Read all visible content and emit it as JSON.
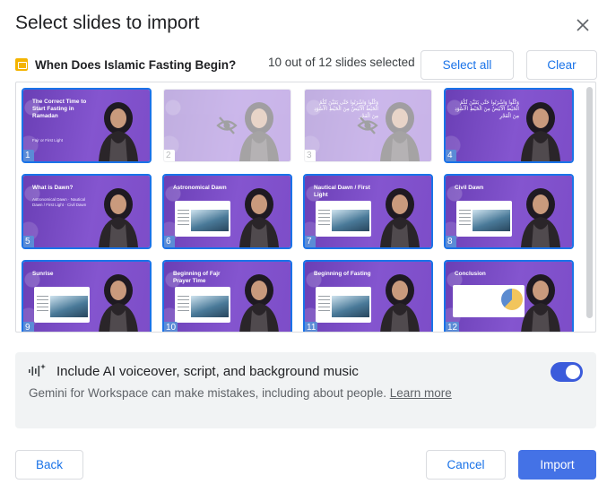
{
  "dialog": {
    "title": "Select slides to import",
    "close_icon": "close-icon"
  },
  "presentation": {
    "icon": "slides-icon",
    "name": "When Does Islamic Fasting Begin?",
    "selection_count": "10 out of 12 slides selected",
    "select_all_label": "Select all",
    "clear_label": "Clear"
  },
  "slides": [
    {
      "number": "1",
      "selected": true,
      "title": "The Correct Time to Start Fasting in Ramadan",
      "subtitle": "Fajr or First Light"
    },
    {
      "number": "2",
      "selected": false,
      "title": "",
      "subtitle": "",
      "hidden_icon": "eye-off-icon"
    },
    {
      "number": "3",
      "selected": false,
      "title": "وَكُلُوا وَاشْرَبُوا حَتَّى يَتَبَيَّنَ لَكُمُ الْخَيْطُ الْأَبْيَضُ مِنَ الْخَيْطِ الْأَسْوَدِ مِنَ الْفَجْرِ",
      "subtitle": "",
      "hidden_icon": "eye-off-icon"
    },
    {
      "number": "4",
      "selected": true,
      "title": "وَكُلُوا وَاشْرَبُوا حَتَّى يَتَبَيَّنَ لَكُمُ الْخَيْطُ الْأَبْيَضُ مِنَ الْخَيْطِ الْأَسْوَدِ مِنَ الْفَجْرِ",
      "subtitle": ""
    },
    {
      "number": "5",
      "selected": true,
      "title": "What is Dawn?",
      "subtitle": "Astronomical Dawn · Nautical Dawn / First Light · Civil Dawn"
    },
    {
      "number": "6",
      "selected": true,
      "title": "Astronomical Dawn",
      "subtitle": ""
    },
    {
      "number": "7",
      "selected": true,
      "title": "Nautical Dawn / First Light",
      "subtitle": ""
    },
    {
      "number": "8",
      "selected": true,
      "title": "Civil Dawn",
      "subtitle": ""
    },
    {
      "number": "9",
      "selected": true,
      "title": "Sunrise",
      "subtitle": ""
    },
    {
      "number": "10",
      "selected": true,
      "title": "Beginning of Fajr Prayer Time",
      "subtitle": ""
    },
    {
      "number": "11",
      "selected": true,
      "title": "Beginning of Fasting",
      "subtitle": ""
    },
    {
      "number": "12",
      "selected": true,
      "title": "Conclusion",
      "subtitle": ""
    }
  ],
  "ai": {
    "icon": "ai-voice-icon",
    "label": "Include AI voiceover, script, and background music",
    "note": "Gemini for Workspace can make mistakes, including about people.",
    "learn_more": "Learn more",
    "enabled": true
  },
  "footer": {
    "back_label": "Back",
    "cancel_label": "Cancel",
    "import_label": "Import"
  },
  "colors": {
    "accent": "#1a73e8",
    "primary_button": "#4472e6",
    "toggle_on": "#3b5bdb",
    "slide_purple": "#7a4cc6",
    "slides_icon": "#f4b400"
  }
}
